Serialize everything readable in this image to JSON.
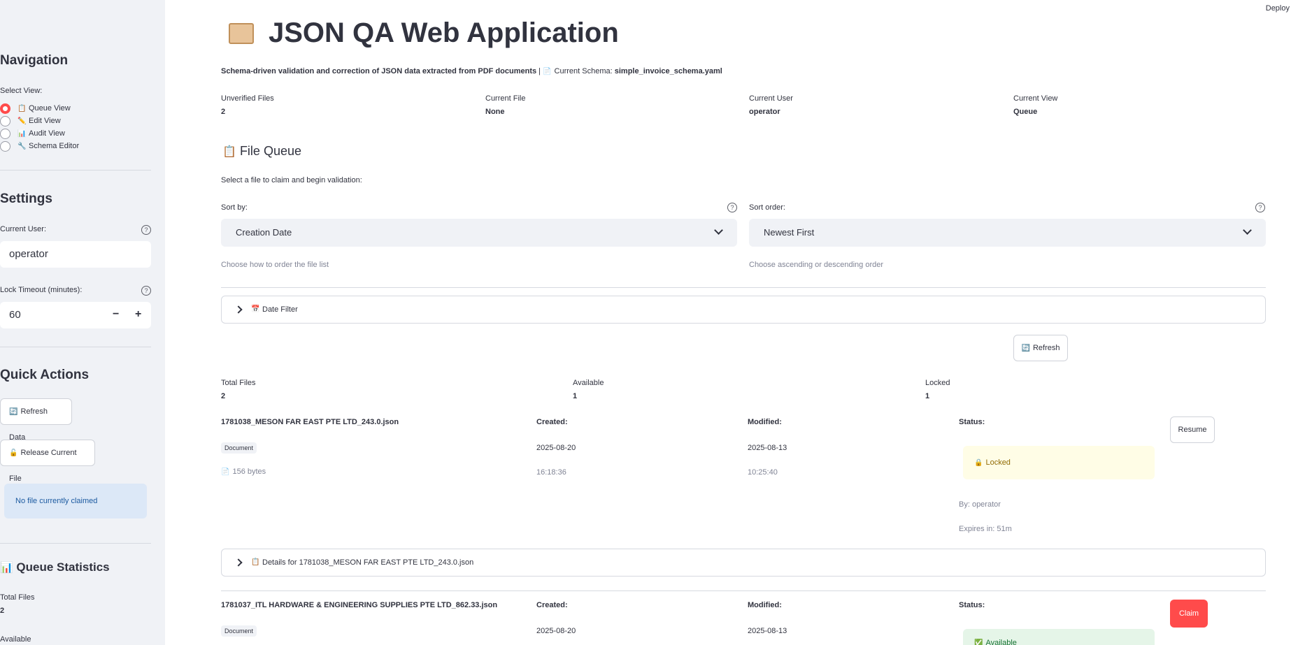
{
  "sidebar": {
    "navigation_title": "Navigation",
    "select_view_label": "Select View:",
    "views": [
      {
        "label": "Queue View",
        "icon": "📋",
        "selected": true
      },
      {
        "label": "Edit View",
        "icon": "✏️",
        "selected": false
      },
      {
        "label": "Audit View",
        "icon": "📊",
        "selected": false
      },
      {
        "label": "Schema Editor",
        "icon": "🔧",
        "selected": false
      }
    ],
    "settings_title": "Settings",
    "current_user_label": "Current User:",
    "current_user_value": "operator",
    "lock_timeout_label": "Lock Timeout (minutes):",
    "lock_timeout_value": "60",
    "minus": "−",
    "plus": "+",
    "quick_actions_title": "Quick Actions",
    "refresh_data_label": "Refresh Data",
    "refresh_icon": "🔄",
    "release_file_label": "Release Current File",
    "release_icon": "🔓",
    "no_file_claimed": "No file currently claimed",
    "queue_stats_title": "Queue Statistics",
    "queue_stats_icon": "📊",
    "stats": [
      {
        "label": "Total Files",
        "value": "2"
      },
      {
        "label": "Available",
        "value": ""
      }
    ]
  },
  "header": {
    "deploy_label": "Deploy",
    "title": "JSON QA Web Application",
    "subtitle_bold": "Schema-driven validation and correction of JSON data extracted from PDF documents",
    "subtitle_sep": " | ",
    "subtitle_schema_label": "Current Schema: ",
    "subtitle_schema_value": "simple_invoice_schema.yaml"
  },
  "metrics": [
    {
      "label": "Unverified Files",
      "value": "2"
    },
    {
      "label": "Current File",
      "value": "None"
    },
    {
      "label": "Current User",
      "value": "operator"
    },
    {
      "label": "Current View",
      "value": "Queue"
    }
  ],
  "queue": {
    "title": "File Queue",
    "title_icon": "📋",
    "instruction": "Select a file to claim and begin validation:",
    "sort_by_label": "Sort by:",
    "sort_by_value": "Creation Date",
    "sort_by_caption": "Choose how to order the file list",
    "sort_order_label": "Sort order:",
    "sort_order_value": "Newest First",
    "sort_order_caption": "Choose ascending or descending order",
    "date_filter_label": "Date Filter",
    "date_filter_icon": "📅",
    "refresh_label": "Refresh",
    "refresh_icon": "🔄",
    "summary": [
      {
        "label": "Total Files",
        "value": "2"
      },
      {
        "label": "Available",
        "value": "1"
      },
      {
        "label": "Locked",
        "value": "1"
      }
    ],
    "files": [
      {
        "name": "1781038_MESON FAR EAST PTE LTD_243.0.json",
        "badge": "Document",
        "size": "156 bytes",
        "created_label": "Created:",
        "created_date": "2025-08-20",
        "created_time": "16:18:36",
        "modified_label": "Modified:",
        "modified_date": "2025-08-13",
        "modified_time": "10:25:40",
        "status_label": "Status:",
        "status_text": "Locked",
        "status_icon": "🔒",
        "locked_by": "By: operator",
        "expires": "Expires in: 51m",
        "action_label": "Resume",
        "details_label": "Details for 1781038_MESON FAR EAST PTE LTD_243.0.json",
        "details_icon": "📋"
      },
      {
        "name": "1781037_ITL HARDWARE & ENGINEERING SUPPLIES PTE LTD_862.33.json",
        "badge": "Document",
        "created_label": "Created:",
        "created_date": "2025-08-20",
        "modified_label": "Modified:",
        "modified_date": "2025-08-13",
        "status_label": "Status:",
        "status_text": "Available",
        "status_icon": "✅",
        "action_label": "Claim"
      }
    ]
  }
}
